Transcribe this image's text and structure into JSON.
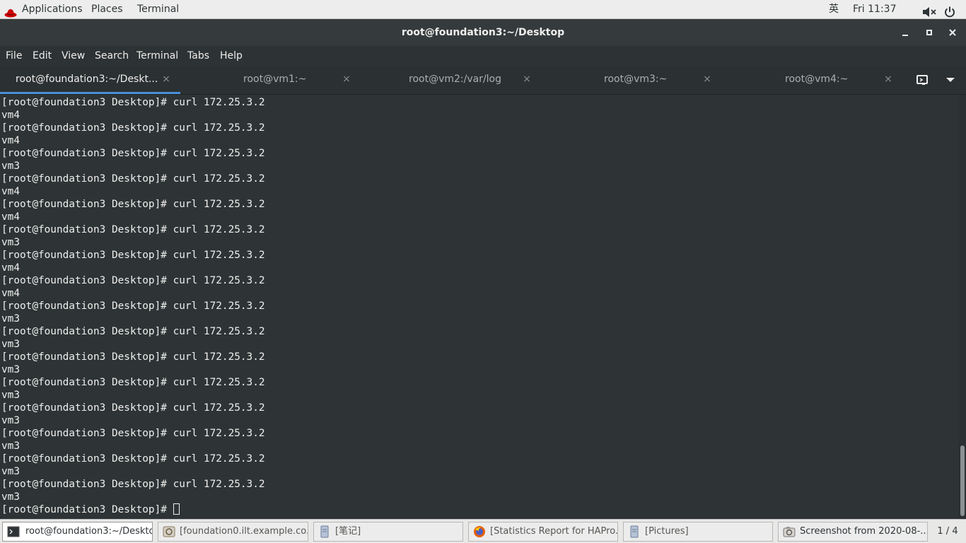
{
  "topbar": {
    "applications": "Applications",
    "places": "Places",
    "terminal": "Terminal",
    "ime": "英",
    "clock": "Fri 11:37",
    "icons": [
      "redhat-icon",
      "volume-muted-icon",
      "power-icon"
    ]
  },
  "window": {
    "title": "root@foundation3:~/Desktop"
  },
  "menubar": {
    "items": [
      "File",
      "Edit",
      "View",
      "Search",
      "Terminal",
      "Tabs",
      "Help"
    ]
  },
  "tabs": [
    {
      "label": "root@foundation3:~/Deskt...",
      "active": true
    },
    {
      "label": "root@vm1:~",
      "active": false
    },
    {
      "label": "root@vm2:/var/log",
      "active": false
    },
    {
      "label": "root@vm3:~",
      "active": false
    },
    {
      "label": "root@vm4:~",
      "active": false
    }
  ],
  "tab_close_glyph": "×",
  "terminal": {
    "lines": [
      "[root@foundation3 Desktop]# curl 172.25.3.2",
      "vm4",
      "[root@foundation3 Desktop]# curl 172.25.3.2",
      "vm4",
      "[root@foundation3 Desktop]# curl 172.25.3.2",
      "vm3",
      "[root@foundation3 Desktop]# curl 172.25.3.2",
      "vm4",
      "[root@foundation3 Desktop]# curl 172.25.3.2",
      "vm4",
      "[root@foundation3 Desktop]# curl 172.25.3.2",
      "vm3",
      "[root@foundation3 Desktop]# curl 172.25.3.2",
      "vm4",
      "[root@foundation3 Desktop]# curl 172.25.3.2",
      "vm4",
      "[root@foundation3 Desktop]# curl 172.25.3.2",
      "vm3",
      "[root@foundation3 Desktop]# curl 172.25.3.2",
      "vm3",
      "[root@foundation3 Desktop]# curl 172.25.3.2",
      "vm3",
      "[root@foundation3 Desktop]# curl 172.25.3.2",
      "vm3",
      "[root@foundation3 Desktop]# curl 172.25.3.2",
      "vm3",
      "[root@foundation3 Desktop]# curl 172.25.3.2",
      "vm3",
      "[root@foundation3 Desktop]# curl 172.25.3.2",
      "vm3",
      "[root@foundation3 Desktop]# curl 172.25.3.2",
      "vm3"
    ],
    "prompt": "[root@foundation3 Desktop]# "
  },
  "taskbar": {
    "items": [
      {
        "label": "root@foundation3:~/Desktop",
        "icon": "terminal-icon",
        "active": true
      },
      {
        "label": "[foundation0.ilt.example.co...",
        "icon": "remote-viewer-icon",
        "active": false
      },
      {
        "label": "[笔记]",
        "icon": "document-icon",
        "active": false
      },
      {
        "label": "[Statistics Report for HAPro...",
        "icon": "firefox-icon",
        "active": false
      },
      {
        "label": "[Pictures]",
        "icon": "folder-icon",
        "active": false
      },
      {
        "label": "Screenshot from 2020-08-...",
        "icon": "screenshot-icon",
        "active": false
      }
    ],
    "pager": "1 / 4"
  }
}
